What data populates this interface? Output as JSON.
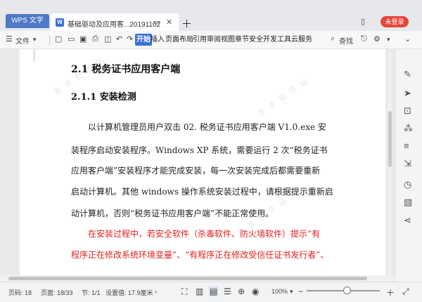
{
  "tabs": {
    "home": "WPS 文字",
    "document": "基础驱动及应用客...20191102"
  },
  "titlebar": {
    "login_label": "未登录"
  },
  "toolbar": {
    "file_label": "文件",
    "ribbon": [
      "开始",
      "插入",
      "页面布局",
      "引用",
      "审阅",
      "视图",
      "章节",
      "安全",
      "开发工具",
      "云服务"
    ],
    "active_ribbon": "开始",
    "search_label": "查找"
  },
  "document": {
    "heading1": "2.1  税务证书应用客户端",
    "heading2": "2.1.1 安装检测",
    "paragraph1": [
      "　　以计算机管理员用户双击 02. 税务证书应用客户端 V1.0.exe 安",
      "装程序启动安装程序。Windows XP 系统，需要运行 2 次“税务证书",
      "应用客户端”安装程序才能完成安装，每一次安装完成后都需要重新",
      "启动计算机。其他 windows 操作系统安装过程中，请根据提示重新启",
      "动计算机，否则“税务证书应用客户端”不能正常使用。"
    ],
    "paragraph2": [
      "　　在安装过程中，若安全软件（杀毒软件、防火墙软件）提示“有",
      "程序正在修改系统环境变量”、“有程序正在修改受信任证书发行者”、"
    ]
  },
  "statusbar": {
    "page_num": "页码: 18",
    "page_total": "页面: 18/33",
    "section": "节: 1/1",
    "position": "设置值: 17.9厘米",
    "zoom": "100%"
  },
  "zoom_percent": 100,
  "colors": {
    "accent": "#3b6fd8",
    "login": "#e8453c",
    "warning_text": "#e31c1c"
  }
}
